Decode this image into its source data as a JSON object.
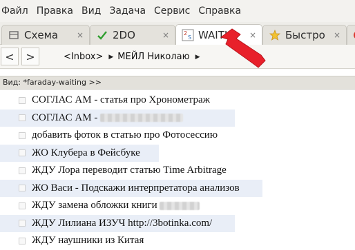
{
  "menu": [
    "Файл",
    "Правка",
    "Вид",
    "Задача",
    "Сервис",
    "Справка"
  ],
  "tabs": [
    {
      "label": "Схема",
      "icon": "schema-icon",
      "close": "×"
    },
    {
      "label": "2DO",
      "icon": "checkmark-icon",
      "close": "×"
    },
    {
      "label": "WAITIN",
      "icon": "waiting-icon",
      "close": "×"
    },
    {
      "label": "Быстро",
      "icon": "star-icon",
      "close": "×"
    }
  ],
  "nav": {
    "back": "<",
    "forward": ">",
    "crumbs": [
      "<Inbox>",
      "МЕЙЛ Николаю"
    ]
  },
  "view_label": "Вид: *faraday-waiting >>",
  "tasks": [
    {
      "text": "СОГЛАС АМ - статья про Хронометраж",
      "hidden_suffix": false
    },
    {
      "text": "СОГЛАС АМ - ",
      "hidden_suffix": true
    },
    {
      "text": "добавить фоток в статью про Фотосессию",
      "hidden_suffix": false
    },
    {
      "text": "ЖО Клубера в Фейсбуке",
      "hidden_suffix": false
    },
    {
      "text": "ЖДУ Лора переводит статью Time Arbitrage",
      "hidden_suffix": false
    },
    {
      "text": "ЖО Васи - Подскажи интерпретатора анализов",
      "hidden_suffix": false
    },
    {
      "text": "ЖДУ замена обложки книги ",
      "hidden_suffix": true
    },
    {
      "text": "ЖДУ Лилиана ИЗУЧ http://3botinka.com/",
      "hidden_suffix": false
    },
    {
      "text": "ЖДУ наушники из Китая",
      "hidden_suffix": false
    }
  ],
  "colors": {
    "accent_arrow": "#e8202a",
    "alt_row": "#e9eef7"
  }
}
